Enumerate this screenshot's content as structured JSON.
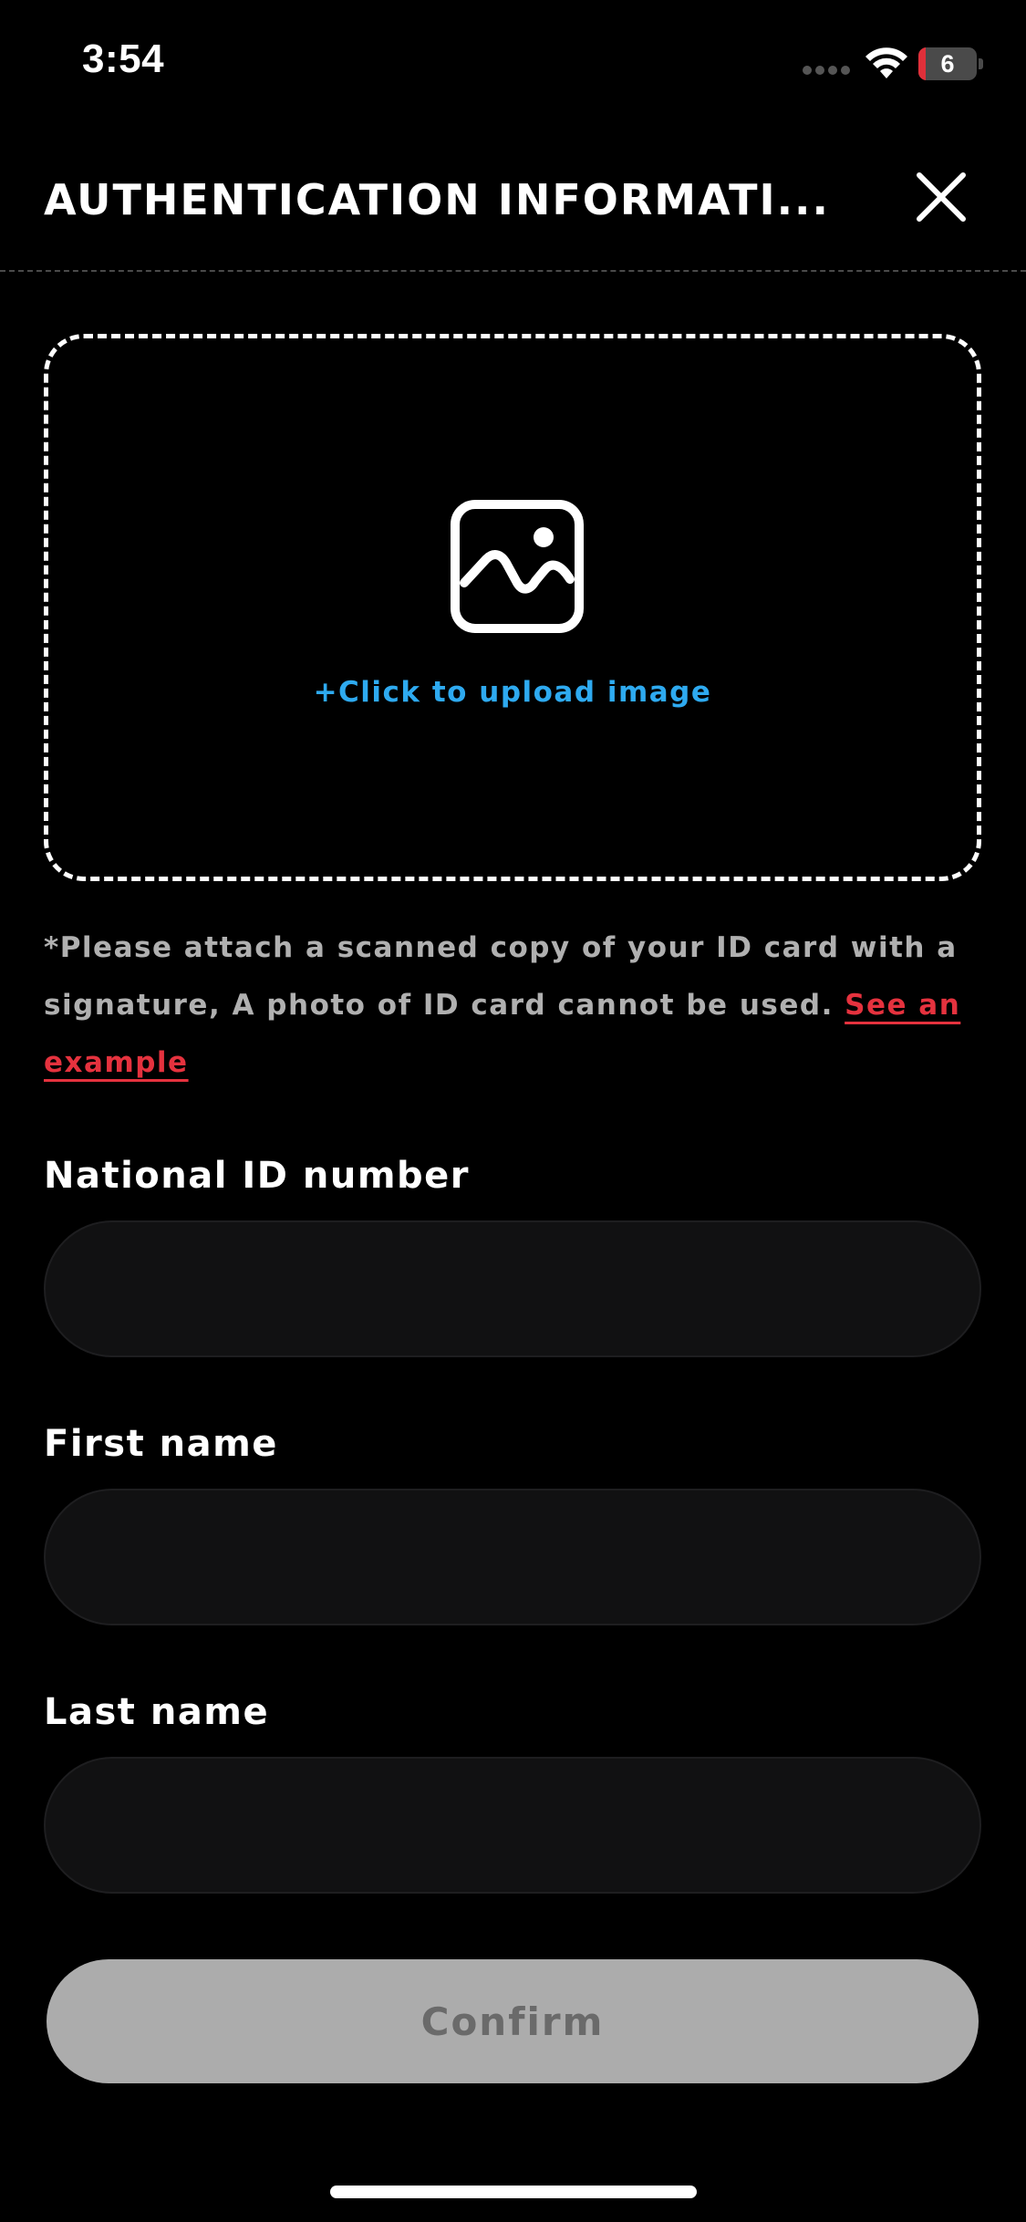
{
  "status_bar": {
    "time": "3:54",
    "battery_level": "6",
    "battery_fraction": 0.06,
    "battery_color": "#e0303a",
    "icons": [
      "signal-dots-icon",
      "wifi-icon",
      "battery-icon"
    ]
  },
  "header": {
    "title": "AUTHENTICATION INFORMATI...",
    "close_icon": "close-icon"
  },
  "upload": {
    "icon": "image-icon",
    "label": "+Click to upload image",
    "label_color": "#2eaaf0"
  },
  "notice": {
    "text": "*Please attach a scanned copy of your ID card with a signature, A photo of ID card cannot be used. ",
    "link_text": "See an example",
    "link_color": "#e5323e"
  },
  "form": {
    "national_id": {
      "label": "National ID number",
      "value": "",
      "placeholder": ""
    },
    "first_name": {
      "label": "First name",
      "value": "",
      "placeholder": ""
    },
    "last_name": {
      "label": "Last name",
      "value": "",
      "placeholder": ""
    }
  },
  "confirm": {
    "label": "Confirm",
    "state": "disabled"
  }
}
